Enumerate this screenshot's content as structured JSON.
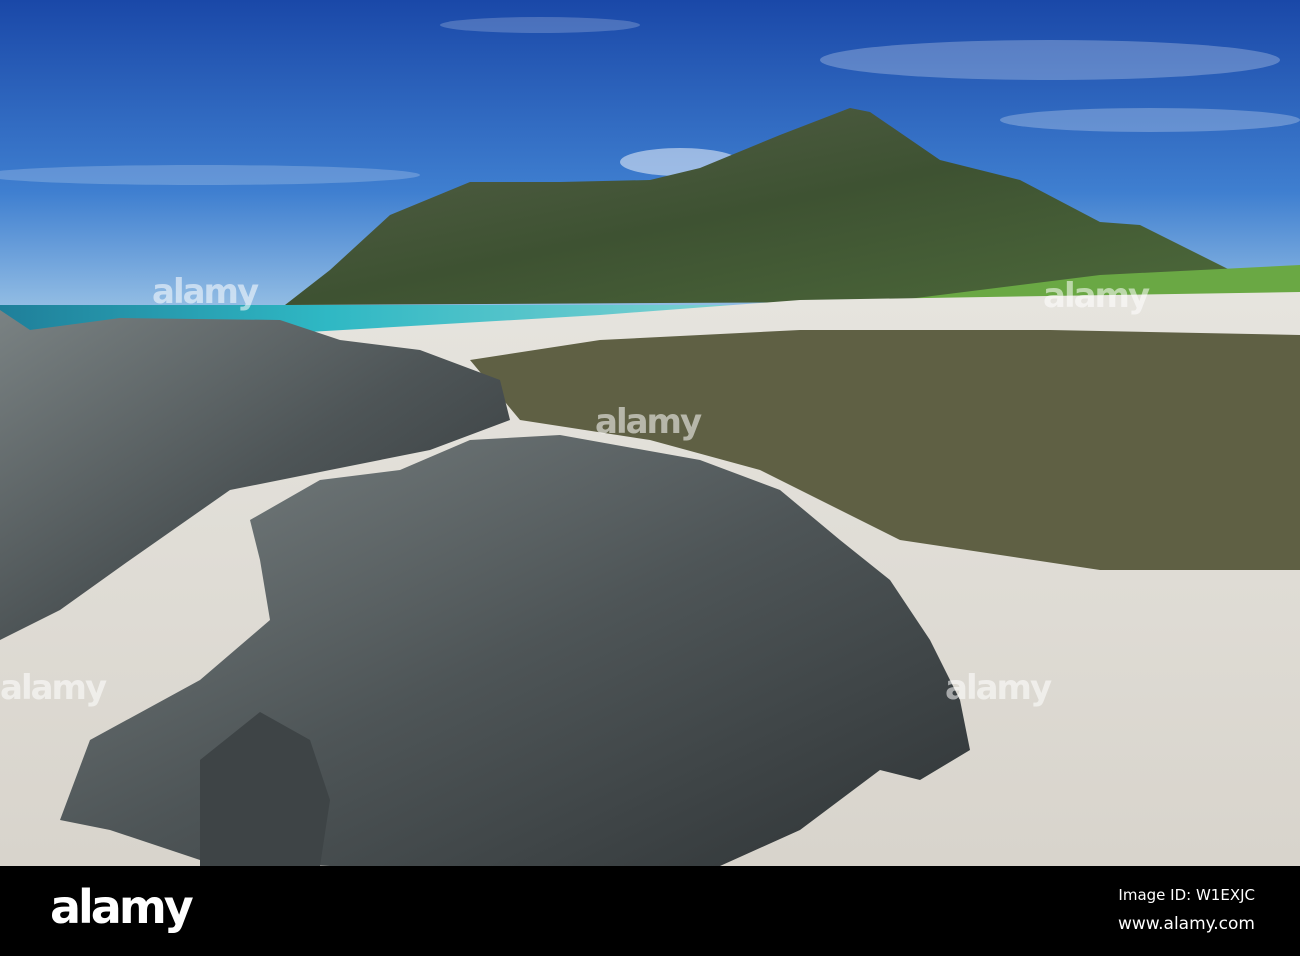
{
  "watermark": {
    "text": "alamy"
  },
  "footer": {
    "logo": "alamy",
    "image_id": "Image ID: W1EXJC",
    "website": "www.alamy.com"
  },
  "colors": {
    "sky_top": "#1b4fae",
    "sky_bottom": "#7fb1e0",
    "sea": "#2fb6c0",
    "sand": "#dcd9d2",
    "rock": "#4d5356",
    "mountain": "#4b5a3a"
  }
}
